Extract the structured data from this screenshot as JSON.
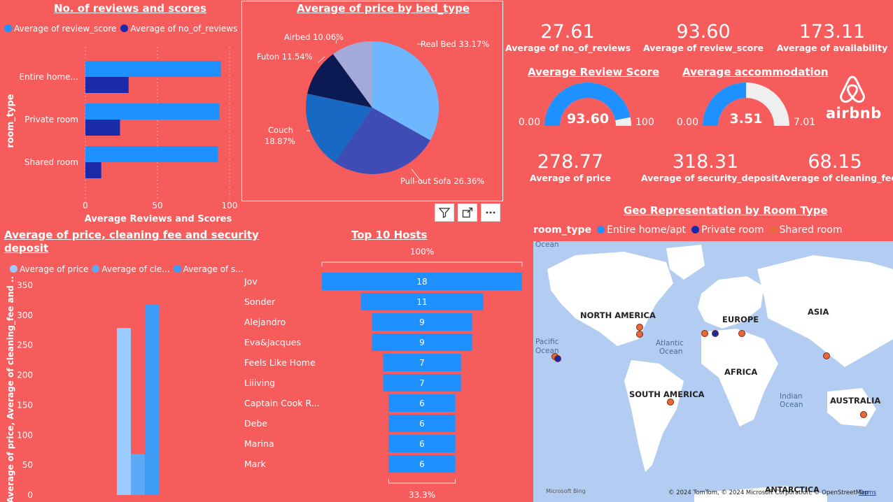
{
  "colors": {
    "background": "#F65C5C",
    "blue": "#1E90FF",
    "navy": "#1A2AA8",
    "light_blue": "#9CCBFF",
    "mid_blue": "#5EA9F5",
    "orange": "#E8683A",
    "map_ocean": "#B3CDF2",
    "map_land": "#FFFFFF"
  },
  "reviews_chart": {
    "title": "No. of reviews and scores",
    "legend": [
      "Average of review_score",
      "Average of no_of_reviews"
    ],
    "ylabel": "room_type",
    "xlabel": "Average Reviews and Scores",
    "ticks": [
      "0",
      "50",
      "100"
    ]
  },
  "pie_chart": {
    "title": "Average of price by bed_type",
    "labels": [
      "Real Bed 33.17%",
      "Pull-out Sofa 26.36%",
      "Couch",
      "18.87%",
      "Futon 11.54%",
      "Airbed 10.06%"
    ]
  },
  "visual_header": {
    "icons": [
      "filter-icon",
      "focus-mode-icon",
      "more-options-icon"
    ]
  },
  "kpis": {
    "no_of_reviews": {
      "value": "27.61",
      "label": "Average of no_of_reviews"
    },
    "review_score": {
      "value": "93.60",
      "label": "Average of review_score"
    },
    "availability": {
      "value": "173.11",
      "label": "Average of availability"
    },
    "price": {
      "value": "278.77",
      "label": "Average of price"
    },
    "security_deposit": {
      "value": "318.31",
      "label": "Average of security_deposit"
    },
    "cleaning_fee": {
      "value": "68.15",
      "label": "Average of cleaning_fee"
    }
  },
  "gauges": {
    "review": {
      "title": "Average Review Score",
      "value": "93.60",
      "min": "0.00",
      "max": "100",
      "fraction": 0.936
    },
    "accommodation": {
      "title": "Average accommodation",
      "value": "3.51",
      "min": "0.00",
      "max": "7.01",
      "fraction": 0.5007
    }
  },
  "logo": {
    "text": "airbnb"
  },
  "price_chart": {
    "title_line1": "Average of price, cleaning fee and security",
    "title_line2": "deposit",
    "legend": [
      "Average of price",
      "Average of cle...",
      "Average of s..."
    ],
    "ylabel": "Average of price, Average of cleaning_fee and ...",
    "ticks": [
      "350",
      "300",
      "250",
      "200",
      "150",
      "100",
      "50",
      "0"
    ]
  },
  "hosts_chart": {
    "title": "Top 10 Hosts",
    "top_pct": "100%",
    "bottom_pct": "33.3%",
    "value_labels": [
      "18",
      "11",
      "9",
      "9",
      "7",
      "7",
      "6",
      "6",
      "6",
      "6"
    ],
    "name_labels": [
      "Jov",
      "Sonder",
      "Alejandro",
      "Eva&Jacques",
      "Feels Like Home",
      "Liiiving",
      "Captain Cook R...",
      "Debe",
      "Marina",
      "Mark"
    ]
  },
  "map": {
    "title": "Geo Representation by Room Type",
    "legend_title": "room_type",
    "legend": [
      "Entire home/apt",
      "Private room",
      "Shared room"
    ],
    "labels": [
      "NORTH AMERICA",
      "EUROPE",
      "ASIA",
      "AFRICA",
      "SOUTH AMERICA",
      "AUSTRALIA",
      "ANTARCTICA",
      "Ocean",
      "Pacific",
      "Ocean",
      "Atlantic",
      "Ocean",
      "Indian",
      "Ocean"
    ],
    "attribution": "© 2024 TomTom, © 2024 Microsoft Corporation, © OpenStreetMap",
    "terms": "Terms",
    "bing": "Microsoft Bing"
  },
  "chart_data": [
    {
      "type": "bar",
      "title": "No. of reviews and scores",
      "orientation": "horizontal",
      "categories": [
        "Entire home...",
        "Private room",
        "Shared room"
      ],
      "series": [
        {
          "name": "Average of review_score",
          "values": [
            94,
            93,
            92
          ]
        },
        {
          "name": "Average of no_of_reviews",
          "values": [
            30,
            24,
            11
          ]
        }
      ],
      "xlabel": "Average Reviews and Scores",
      "ylabel": "room_type",
      "xlim": [
        0,
        100
      ]
    },
    {
      "type": "pie",
      "title": "Average of price by bed_type",
      "categories": [
        "Real Bed",
        "Pull-out Sofa",
        "Couch",
        "Futon",
        "Airbed"
      ],
      "values": [
        33.17,
        26.36,
        18.87,
        11.54,
        10.06
      ]
    },
    {
      "type": "bar",
      "title": "Average of price, cleaning fee and security deposit",
      "series": [
        {
          "name": "Average of price",
          "values": [
            278.77
          ]
        },
        {
          "name": "Average of cle...",
          "values": [
            68.15
          ]
        },
        {
          "name": "Average of s...",
          "values": [
            318.31
          ]
        }
      ],
      "ylim": [
        0,
        350
      ]
    },
    {
      "type": "bar",
      "title": "Top 10 Hosts",
      "orientation": "funnel",
      "categories": [
        "Jov",
        "Sonder",
        "Alejandro",
        "Eva&Jacques",
        "Feels Like Home",
        "Liiiving",
        "Captain Cook R...",
        "Debe",
        "Marina",
        "Mark"
      ],
      "values": [
        18,
        11,
        9,
        9,
        7,
        7,
        6,
        6,
        6,
        6
      ]
    }
  ]
}
